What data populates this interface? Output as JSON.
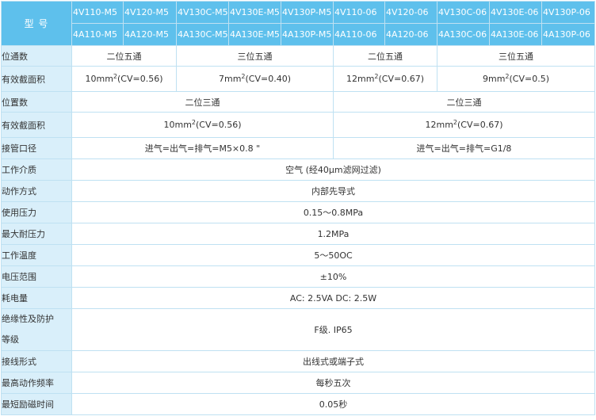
{
  "header": {
    "title": "型 号",
    "row1": [
      "4V110-M5",
      "4V120-M5",
      "4V130C-M5",
      "4V130E-M5",
      "4V130P-M5",
      "4V110-06",
      "4V120-06",
      "4V130C-06",
      "4V130E-06",
      "4V130P-06"
    ],
    "row2": [
      "4A110-M5",
      "4A120-M5",
      "4A130C-M5",
      "4A130E-M5",
      "4A130P-M5",
      "4A110-06",
      "4A120-06",
      "4A130C-06",
      "4A130E-06",
      "4A130P-06"
    ]
  },
  "rows": {
    "positions5": {
      "label": "位通数",
      "m5_two": "二位五通",
      "m5_three": "三位五通",
      "g_two": "二位五通",
      "g_three": "三位五通"
    },
    "area5": {
      "label": "有效截面积",
      "m5_two": {
        "pre": "10mm",
        "sup": "2",
        "post": "(CV=0.56)"
      },
      "m5_three": {
        "pre": "7mm",
        "sup": "2",
        "post": "(CV=0.40)"
      },
      "g_two": {
        "pre": "12mm",
        "sup": "2",
        "post": "(CV=0.67)"
      },
      "g_three": {
        "pre": "9mm",
        "sup": "2",
        "post": "(CV=0.5)"
      }
    },
    "positions3": {
      "label": "位置数",
      "m5": "二位三通",
      "g": "二位三通"
    },
    "area3": {
      "label": "有效截面积",
      "m5": {
        "pre": "10mm",
        "sup": "2",
        "post": "(CV=0.56)"
      },
      "g": {
        "pre": "12mm",
        "sup": "2",
        "post": "(CV=0.67)"
      }
    },
    "port": {
      "label": "接管口径",
      "m5": "进气=出气=排气=M5×0.8 \"",
      "g": "进气=出气=排气=G1/8"
    },
    "medium": {
      "label": "工作介质",
      "value": "空气 (经40μm滤网过滤)"
    },
    "action": {
      "label": "动作方式",
      "value": "内部先导式"
    },
    "pressure": {
      "label": "使用压力",
      "value": "0.15～0.8MPa"
    },
    "proof": {
      "label": "最大耐压力",
      "value": "1.2MPa"
    },
    "temp": {
      "label": "工作温度",
      "value": "5～50OC"
    },
    "voltage": {
      "label": "电压范围",
      "value": "±10%"
    },
    "power": {
      "label": "耗电量",
      "value": "AC: 2.5VA DC: 2.5W"
    },
    "insulation": {
      "label_line1": "绝缘性及防护",
      "label_line2": "等级",
      "value": "F级. IP65"
    },
    "wiring": {
      "label": "接线形式",
      "value": "出线式或端子式"
    },
    "freq": {
      "label": "最高动作频率",
      "value": "每秒五次"
    },
    "excite": {
      "label": "最短励磁时间",
      "value": "0.05秒"
    }
  }
}
